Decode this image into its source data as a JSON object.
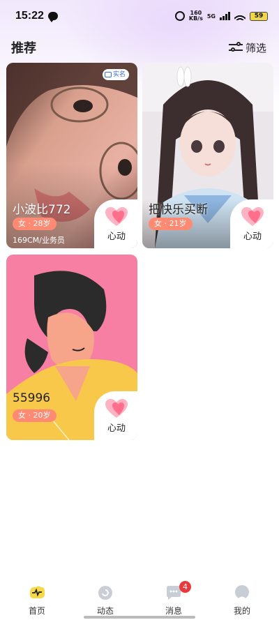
{
  "status_bar": {
    "time": "15:22",
    "net_speed_value": "160",
    "net_speed_unit": "KB/s",
    "network": "5G",
    "battery": "59"
  },
  "header": {
    "title": "推荐",
    "filter_label": "筛选"
  },
  "cards": [
    {
      "name": "小波比772",
      "age": "女 · 28岁",
      "info": "169CM/业务员",
      "like_label": "心动",
      "verified_label": "实名"
    },
    {
      "name": "把快乐买断",
      "age": "女 · 21岁",
      "like_label": "心动"
    },
    {
      "name": "55996",
      "age": "女 · 20岁",
      "like_label": "心动"
    }
  ],
  "tabs": [
    {
      "label": "首页",
      "icon": "home-icon",
      "active": true
    },
    {
      "label": "动态",
      "icon": "moments-icon"
    },
    {
      "label": "消息",
      "icon": "message-icon",
      "badge": "4"
    },
    {
      "label": "我的",
      "icon": "profile-icon"
    }
  ],
  "colors": {
    "accent_tag": "#ff8a73",
    "badge": "#e83a3a",
    "home_icon": "#f6d94a",
    "card3_bg": "#f77fa4"
  }
}
